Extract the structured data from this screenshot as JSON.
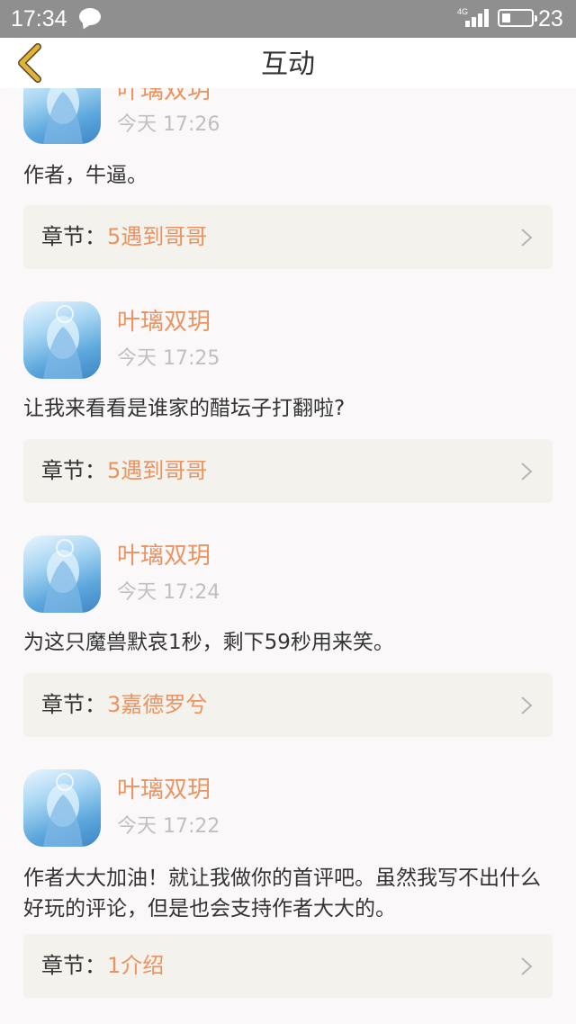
{
  "status_bar": {
    "time": "17:34",
    "network": "4G",
    "battery_level": "23",
    "icons": [
      "chat-bubble-icon",
      "signal-icon",
      "battery-icon"
    ]
  },
  "header": {
    "title": "互动",
    "back_icon": "chevron-left-icon"
  },
  "colors": {
    "accent": "#eb9360",
    "back_icon": "#e1b33a",
    "card_bg": "#f3f2ec",
    "timestamp": "#c0c0c0",
    "status_bar": "#8f8f8f"
  },
  "comments": [
    {
      "username": "叶璃双玥",
      "time": "今天 17:26",
      "text": "作者，牛逼。",
      "chapter_label": "章节：",
      "chapter": "5遇到哥哥"
    },
    {
      "username": "叶璃双玥",
      "time": "今天 17:25",
      "text": "让我来看看是谁家的醋坛子打翻啦?",
      "chapter_label": "章节：",
      "chapter": "5遇到哥哥"
    },
    {
      "username": "叶璃双玥",
      "time": "今天 17:24",
      "text": "为这只魔兽默哀1秒，剩下59秒用来笑。",
      "chapter_label": "章节：",
      "chapter": "3嘉德罗兮"
    },
    {
      "username": "叶璃双玥",
      "time": "今天 17:22",
      "text": "作者大大加油！就让我做你的首评吧。虽然我写不出什么好玩的评论，但是也会支持作者大大的。",
      "chapter_label": "章节：",
      "chapter": "1介绍"
    }
  ]
}
